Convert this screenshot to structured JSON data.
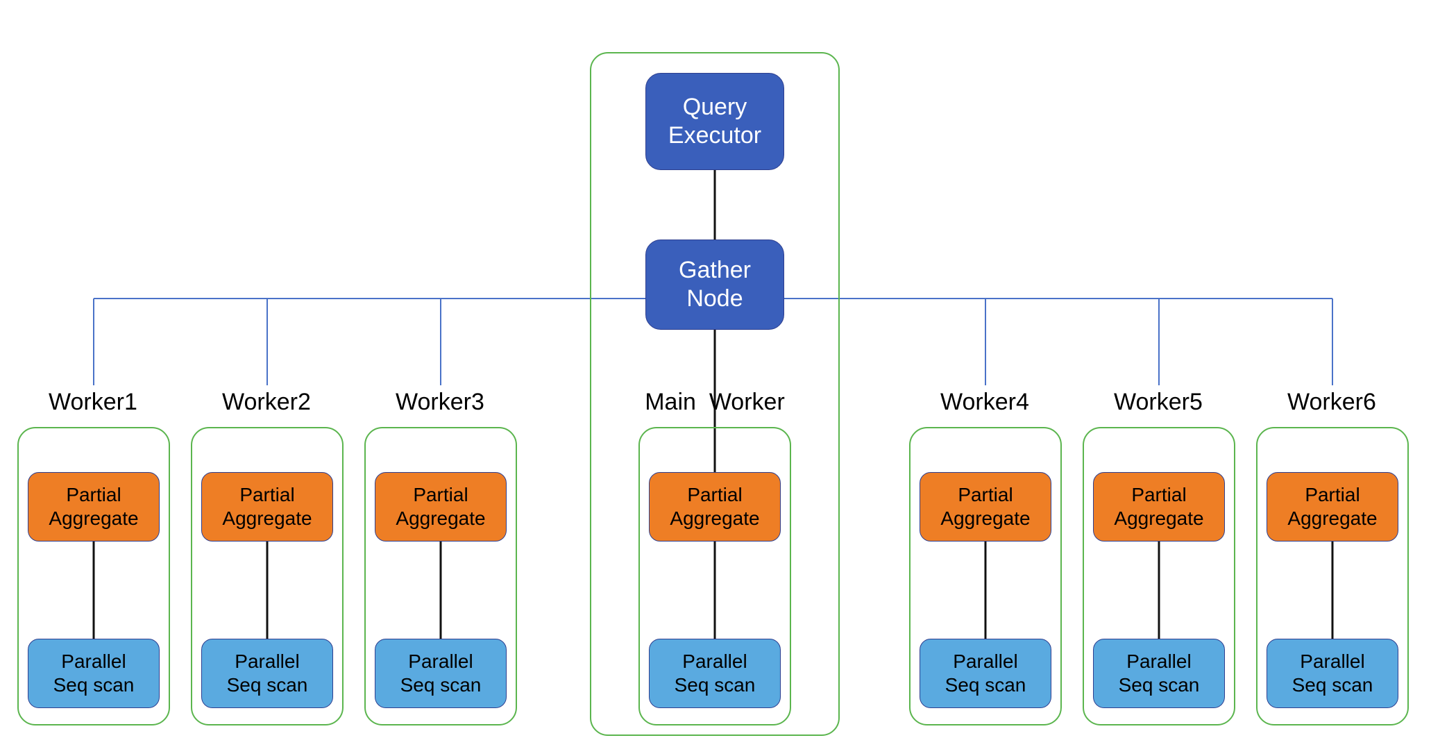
{
  "top": {
    "query_executor": "Query\nExecutor",
    "gather_node": "Gather\nNode"
  },
  "labels": {
    "main_worker": "Main  Worker",
    "worker1": "Worker1",
    "worker2": "Worker2",
    "worker3": "Worker3",
    "worker4": "Worker4",
    "worker5": "Worker5",
    "worker6": "Worker6"
  },
  "node": {
    "partial_aggregate": "Partial\nAggregate",
    "parallel_seq_scan": "Parallel\nSeq scan"
  },
  "colors": {
    "blue": "#3a5fbb",
    "orange": "#ee7e25",
    "lightblue": "#5aaae0",
    "green_border": "#5bb54e",
    "wire_blue": "#4a72c8",
    "wire_black": "#111111"
  }
}
